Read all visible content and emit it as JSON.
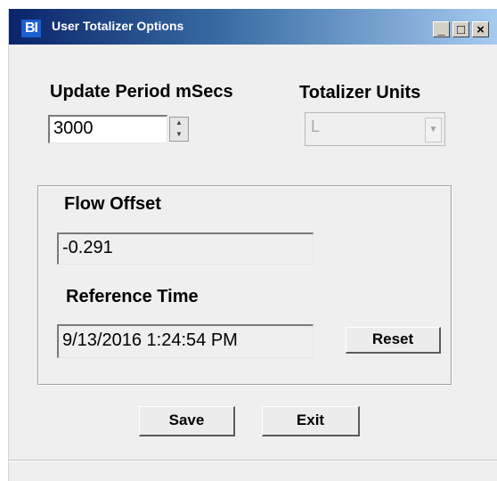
{
  "window": {
    "title": "User Totalizer Options",
    "icon_text": "BI",
    "caption_buttons": {
      "minimize": "_",
      "maximize": "□",
      "close": "×"
    }
  },
  "update_period": {
    "label": "Update Period mSecs",
    "value": "3000",
    "spin_up": "▲",
    "spin_down": "▼"
  },
  "totalizer_units": {
    "label": "Totalizer Units",
    "selected": "L",
    "arrow": "▼"
  },
  "flow_offset": {
    "label": "Flow Offset",
    "value": "-0.291"
  },
  "reference_time": {
    "label": "Reference Time",
    "value": "9/13/2016 1:24:54 PM",
    "reset_label": "Reset"
  },
  "buttons": {
    "save_label": "Save",
    "exit_label": "Exit"
  }
}
